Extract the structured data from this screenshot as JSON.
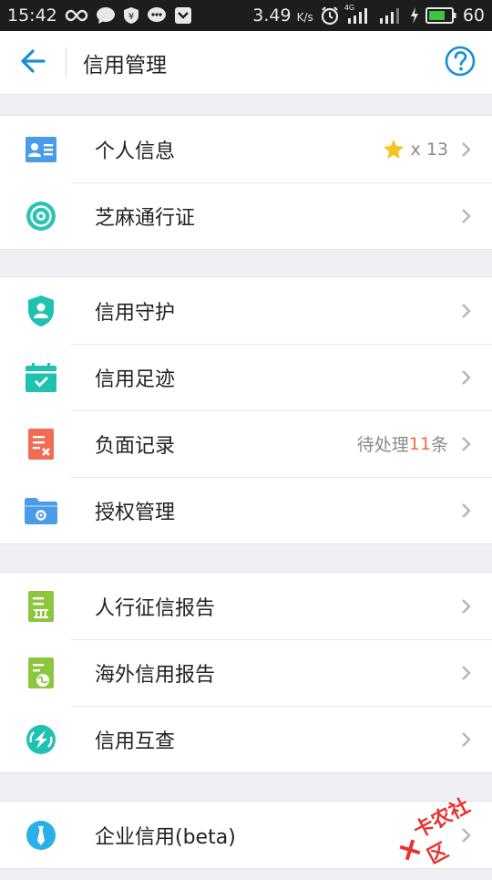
{
  "status_bar": {
    "time": "15:42",
    "speed": "3.49",
    "speed_unit": "K/s",
    "network_label": "4G",
    "battery": "60"
  },
  "nav": {
    "title": "信用管理",
    "back_icon": "arrow-left-icon",
    "help_icon": "question-circle-icon",
    "accent_color": "#1a8fd6"
  },
  "groups": [
    {
      "items": [
        {
          "label": "个人信息",
          "icon": "id-card-icon",
          "color": "#4a9be8",
          "extra_prefix": "x 13",
          "has_star": true
        },
        {
          "label": "芝麻通行证",
          "icon": "sesame-pass-icon",
          "color": "#2cc3b5"
        }
      ]
    },
    {
      "items": [
        {
          "label": "信用守护",
          "icon": "shield-user-icon",
          "color": "#1fc1b0"
        },
        {
          "label": "信用足迹",
          "icon": "calendar-check-icon",
          "color": "#1fc1b0"
        },
        {
          "label": "负面记录",
          "icon": "negative-record-icon",
          "color": "#f26b55",
          "pending_text": "待处理",
          "pending_count": "11",
          "pending_unit": "条"
        },
        {
          "label": "授权管理",
          "icon": "folder-gear-icon",
          "color": "#4a9be8"
        }
      ]
    },
    {
      "items": [
        {
          "label": "人行征信报告",
          "icon": "bank-report-icon",
          "color": "#8cc63f"
        },
        {
          "label": "海外信用报告",
          "icon": "overseas-report-icon",
          "color": "#8cc63f"
        },
        {
          "label": "信用互查",
          "icon": "mutual-check-icon",
          "color": "#1fc1b0"
        }
      ]
    },
    {
      "items": [
        {
          "label": "企业信用(beta)",
          "icon": "tie-icon",
          "color": "#2ab0e8"
        }
      ]
    }
  ],
  "watermark": {
    "text": "卡农社区"
  }
}
